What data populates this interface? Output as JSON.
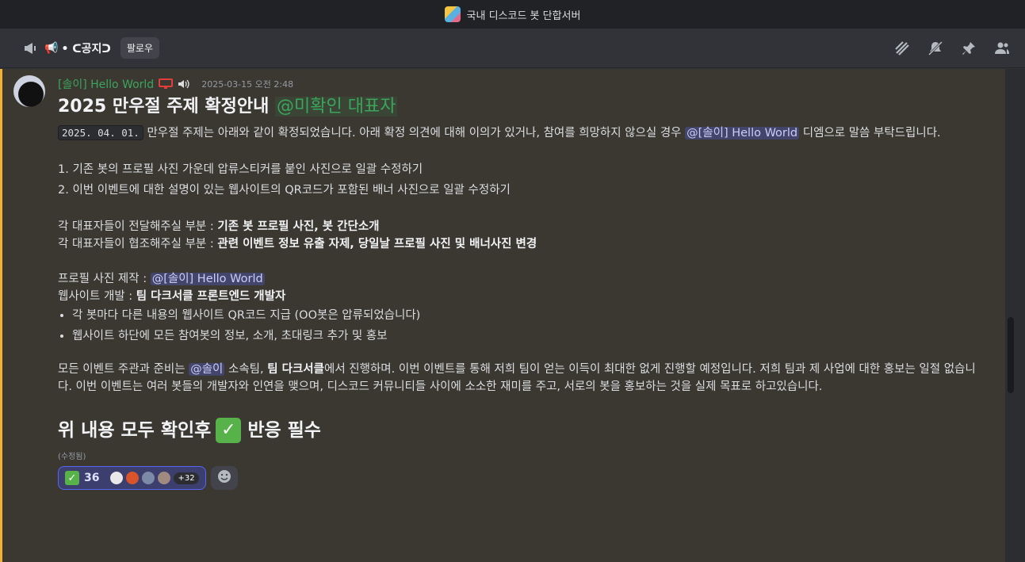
{
  "window": {
    "server_name": "국내 디스코드 봇 단합서버",
    "server_icon": "server-avatar"
  },
  "channel": {
    "icon": "announcement-megaphone-icon",
    "emoji": "📢",
    "name": "• ᑕ공지ᑐ",
    "follow_label": "팔로우"
  },
  "header_icons": [
    "threads-icon",
    "mute-notifications-icon",
    "pin-icon",
    "member-list-icon"
  ],
  "message": {
    "username": "[솔이] Hello World",
    "timestamp": "2025-03-15 오전 2:48",
    "title": "2025 만우절 주제 확정안내",
    "title_mention": "@미확인 대표자",
    "intro_code": "2025. 04. 01.",
    "intro_text": " 만우절 주제는 아래와 같이 확정되었습니다. 아래 확정 의견에 대해 이의가 있거나, 참여를 희망하지 않으실 경우 ",
    "intro_mention": "@[솔이] Hello World",
    "intro_tail": " 디엠으로 말씀 부탁드립니다.",
    "list1": "1. 기존 봇의 프로필 사진 가운데 압류스티커를 붙인 사진으로 일괄 수정하기",
    "list2": "2. 이번 이벤트에 대한 설명이 있는 웹사이트의 QR코드가 포함된 배너 사진으로 일괄 수정하기",
    "deliver_label": "각 대표자들이 전달해주실 부분  : ",
    "deliver_value": "기존 봇 프로필 사진, 봇 간단소개",
    "coop_label": "각 대표자들이 협조해주실 부분 :  ",
    "coop_value": "관련 이벤트 정보 유출 자제, 당일날 프로필 사진 및 배너사진 변경",
    "profile_label": "프로필 사진 제작 : ",
    "profile_mention": "@[솔이] Hello World",
    "web_label": "웹사이트 개발 : ",
    "web_value": "팀 다크서클 프론트엔드 개발자",
    "bullets": [
      "각 봇마다 다른 내용의 웹사이트 QR코드 지급 (OO봇은 압류되었습니다)",
      "웹사이트 하단에 모든 참여봇의 정보, 소개, 초대링크 추가 및 홍보"
    ],
    "closing_a": "모든 이벤트 주관과 준비는 ",
    "closing_mention": "@솔이",
    "closing_b": " 소속팀, ",
    "closing_bold": "팀 다크서클",
    "closing_c": "에서 진행하며. 이번 이벤트를 통해 저희 팀이 얻는 이득이 최대한 없게 진행할 예정입니다. 저희 팀과 제 사업에 대한 홍보는 일절 없습니다. 이번 이벤트는 여러 봇들의 개발자와 인연을 맺으며, 디스코드 커뮤니티들 사이에 소소한 재미를 주고, 서로의 봇을 홍보하는 것을 실제 목표로 하고있습니다.",
    "footer_heading_a": "위 내용 모두 확인후",
    "footer_heading_b": "반응 필수",
    "edited": "(수정됨)",
    "reaction_count": "36",
    "reaction_more": "+32"
  },
  "colors": {
    "accent": "#5865f2",
    "username": "#3ba55c",
    "highlight_bar": "#f0b232"
  }
}
